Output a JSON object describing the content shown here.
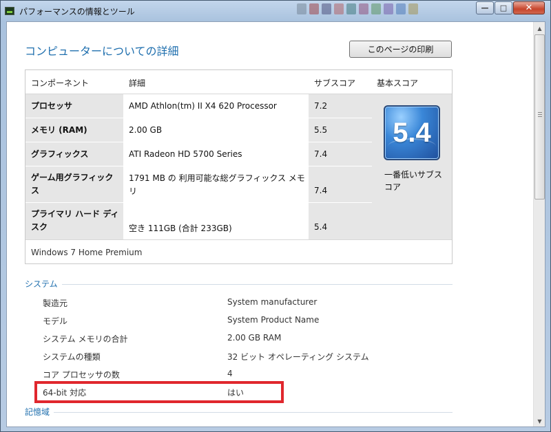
{
  "window": {
    "title": "パフォーマンスの情報とツール",
    "minimize": "—",
    "maximize": "□",
    "close": "✕"
  },
  "heading": "コンピューターについての詳細",
  "print_button": "このページの印刷",
  "score_table": {
    "headers": {
      "component": "コンポーネント",
      "detail": "詳細",
      "subscore": "サブスコア",
      "basescore": "基本スコア"
    },
    "rows": [
      {
        "component": "プロセッサ",
        "detail": "AMD Athlon(tm) II X4 620 Processor",
        "subscore": "7.2"
      },
      {
        "component": "メモリ (RAM)",
        "detail": "2.00 GB",
        "subscore": "5.5"
      },
      {
        "component": "グラフィックス",
        "detail": "ATI Radeon HD 5700 Series",
        "subscore": "7.4"
      },
      {
        "component": "ゲーム用グラフィックス",
        "detail": "1791 MB の 利用可能な総グラフィックス メモリ",
        "subscore": "7.4"
      },
      {
        "component": "プライマリ ハード ディスク",
        "detail": "空き 111GB (合計 233GB)",
        "subscore": "5.4"
      }
    ],
    "base_score": "5.4",
    "base_score_label": "一番低いサブスコア",
    "os": "Windows 7 Home Premium"
  },
  "system": {
    "title": "システム",
    "items": [
      {
        "key": "製造元",
        "value": "System manufacturer"
      },
      {
        "key": "モデル",
        "value": "System Product Name"
      },
      {
        "key": "システム メモリの合計",
        "value": "2.00 GB RAM"
      },
      {
        "key": "システムの種類",
        "value": "32 ビット オペレーティング システム"
      },
      {
        "key": "コア プロセッサの数",
        "value": "4"
      },
      {
        "key": "64-bit 対応",
        "value": "はい"
      }
    ]
  },
  "storage": {
    "title": "記憶域"
  },
  "colors": {
    "heading": "#1f6fae",
    "highlight": "#e0272d",
    "close_button": "#c7452c"
  }
}
